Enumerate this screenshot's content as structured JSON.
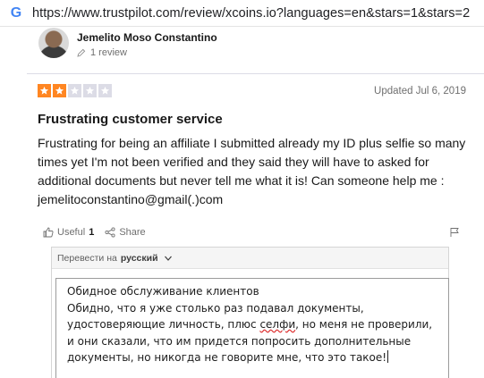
{
  "browser": {
    "url": "https://www.trustpilot.com/review/xcoins.io?languages=en&stars=1&stars=2",
    "favicon_icon": "google-g-icon"
  },
  "reviewer": {
    "name": "Jemelito Moso Constantino",
    "review_count": "1 review"
  },
  "review": {
    "rating": 2,
    "max_rating": 5,
    "star_color_on": "#ff8622",
    "star_color_off": "#dcdce6",
    "updated": "Updated Jul 6, 2019",
    "title": "Frustrating customer service",
    "body": "Frustrating for being an affiliate I submitted already my ID plus selfie so many times yet I'm not been verified and they said they will have to asked for additional documents but never tell me what it is! Can someone help me : jemelitoconstantino@gmail(.)com"
  },
  "actions": {
    "useful_label": "Useful",
    "useful_count": "1",
    "share_label": "Share"
  },
  "translate": {
    "prefix": "Перевести на",
    "language": "русский",
    "lines": [
      "Обидное обслуживание клиентов",
      "Обидно, что я уже столько раз подавал документы,",
      "удостоверяющие личность, плюс ",
      "и они сказали, что им придется попросить дополнительные",
      "документы, но никогда не говорите мне, что это такое!"
    ],
    "line3_underlined": "селфи",
    "line3_rest": ", но меня не проверили,"
  }
}
